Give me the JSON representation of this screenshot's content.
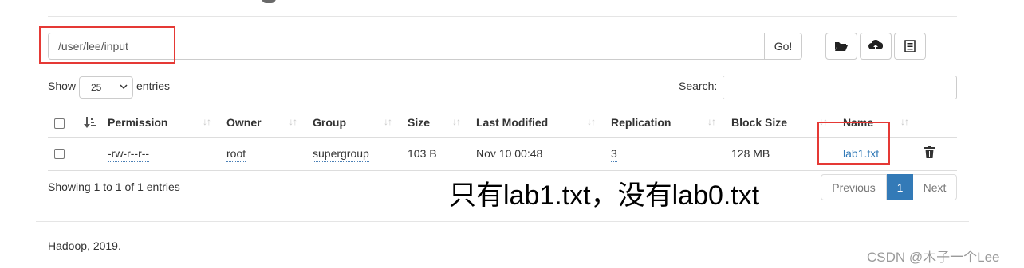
{
  "toolbar": {
    "path_value": "/user/lee/input",
    "go_label": "Go!",
    "icons": [
      "folder-open-icon",
      "cloud-upload-icon",
      "list-icon"
    ]
  },
  "controls": {
    "show_label": "Show",
    "page_size": "25",
    "entries_label": "entries",
    "search_label": "Search:"
  },
  "table": {
    "columns": [
      "Permission",
      "Owner",
      "Group",
      "Size",
      "Last Modified",
      "Replication",
      "Block Size",
      "Name"
    ],
    "rows": [
      {
        "permission": "-rw-r--r--",
        "owner": "root",
        "group": "supergroup",
        "size": "103 B",
        "last_modified": "Nov 10 00:48",
        "replication": "3",
        "block_size": "128 MB",
        "name": "lab1.txt"
      }
    ]
  },
  "info": "Showing 1 to 1 of 1 entries",
  "pagination": {
    "previous": "Previous",
    "current": "1",
    "next": "Next"
  },
  "annotation": "只有lab1.txt，没有lab0.txt",
  "footer": "Hadoop, 2019.",
  "watermark": "CSDN @木子一个Lee",
  "colors": {
    "link": "#337ab7",
    "highlight": "#e53935"
  }
}
